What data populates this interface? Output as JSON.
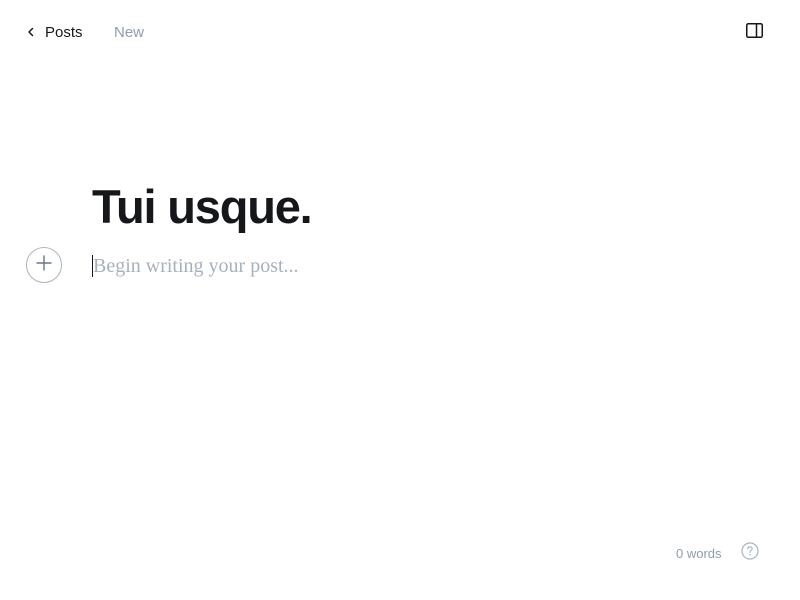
{
  "header": {
    "back_label": "Posts",
    "status_label": "New",
    "back_icon": "chevron-left-icon",
    "sidebar_icon": "sidebar-toggle-icon"
  },
  "editor": {
    "title": "Tui usque.",
    "body_placeholder": "Begin writing your post...",
    "add_card_icon": "plus-icon"
  },
  "footer": {
    "word_count": "0 words",
    "help_icon": "question-mark-icon"
  },
  "colors": {
    "text": "#15171a",
    "muted": "#8e9cac",
    "placeholder": "#a6b1bd",
    "border": "#aab4bf"
  }
}
